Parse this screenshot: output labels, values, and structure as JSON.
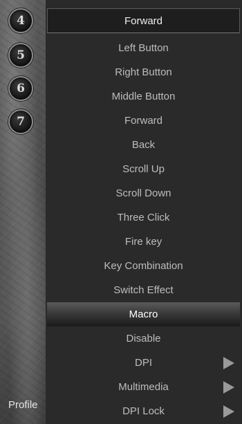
{
  "sidebar": {
    "buttons": [
      "4",
      "5",
      "6",
      "7"
    ],
    "profile_label": "Profile"
  },
  "menu": {
    "current": "Forward",
    "items": [
      {
        "label": "Left Button"
      },
      {
        "label": "Right Button"
      },
      {
        "label": "Middle Button"
      },
      {
        "label": "Forward"
      },
      {
        "label": "Back"
      },
      {
        "label": "Scroll Up"
      },
      {
        "label": "Scroll Down"
      },
      {
        "label": "Three Click"
      },
      {
        "label": "Fire key"
      },
      {
        "label": "Key Combination"
      },
      {
        "label": "Switch Effect"
      },
      {
        "label": "Macro",
        "selected": true
      },
      {
        "label": "Disable"
      },
      {
        "label": "DPI",
        "submenu": true
      },
      {
        "label": "Multimedia",
        "submenu": true
      },
      {
        "label": "DPI Lock",
        "submenu": true
      }
    ]
  }
}
